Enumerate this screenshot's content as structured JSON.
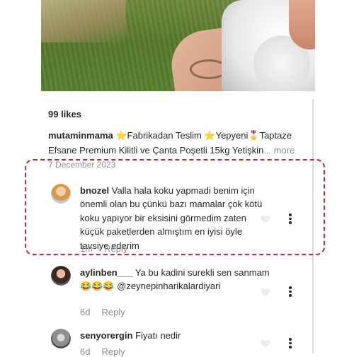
{
  "post": {
    "likes": "99 likes",
    "caption_user": "mutaminmama",
    "caption_text": " ⭐Fabrikadan Teslim ⭐Yepyeni🎖️Taptaze Efsane Premium Kilitli ve Çanta Poşetli 15kg Yetişkin",
    "caption_more": "... more",
    "date": "7 December 2023"
  },
  "comments": [
    {
      "username": "bnozel",
      "text": "Valla hala koku yapmadi benim için önemli olan bu çünkü bazı mamalar çok kötü koku yapıyor bir eksisini görmedim zaten küçük paketlerden almıştım en iyisi öyle tavsiye ederim",
      "time": "1m",
      "reply": "Reply"
    },
    {
      "username": "aylinben___",
      "text": "Ya bu kadini surekli sen sanmam 😂😂😂 @zeynepinharikalardiyari",
      "time": "6d",
      "reply": "Reply"
    },
    {
      "username": "senyorergin",
      "text": "Fiyatı nedir",
      "time": "6d",
      "reply": "Reply"
    }
  ],
  "colors": {
    "highlight_border": "#d51f2a",
    "muted_text": "#8e8e8e"
  },
  "icons": [
    "heart-icon",
    "more-options-icon"
  ]
}
